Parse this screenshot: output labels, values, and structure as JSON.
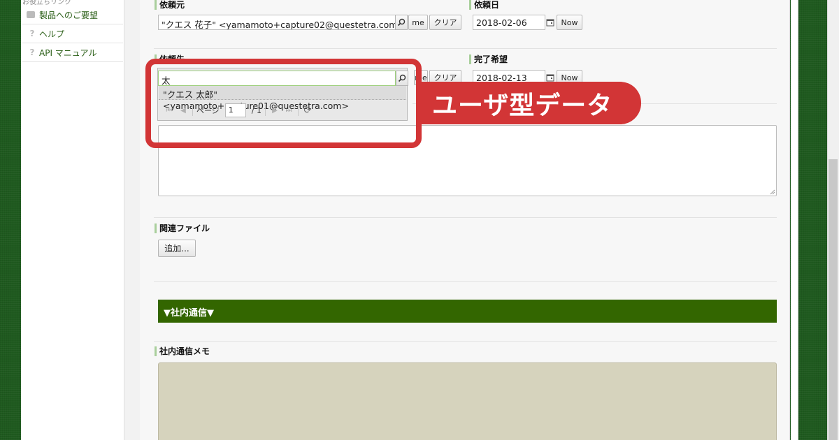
{
  "sidebar": {
    "truncated_heading": "お役立ちリンク",
    "items": [
      {
        "label": "製品へのご要望",
        "icon": "feedback-icon"
      },
      {
        "label": "ヘルプ",
        "icon": "help-icon"
      },
      {
        "label": "API マニュアル",
        "icon": "help-icon"
      }
    ]
  },
  "form": {
    "requester": {
      "label": "依頼元",
      "value": "\"クエス 花子\" <yamamoto+capture02@questetra.com>",
      "me_label": "me",
      "clear_label": "クリア"
    },
    "request_date": {
      "label": "依頼日",
      "value": "2018-02-06",
      "now_label": "Now"
    },
    "assignee": {
      "label": "依頼先",
      "value": "太",
      "me_label": "me",
      "clear_label": "クリア"
    },
    "due_date": {
      "label": "完了希望",
      "value": "2018-02-13",
      "now_label": "Now"
    },
    "attachments": {
      "label": "関連ファイル",
      "add_label": "追加..."
    },
    "internal_section": {
      "header": "▼社内通信▼",
      "memo_label": "社内通信メモ"
    }
  },
  "autocomplete": {
    "suggestion": "\"クエス 太郎\" <yamamoto+capture01@questetra.com>",
    "pager": {
      "page_label": "ページ",
      "page_value": "1",
      "total": "/ 1"
    }
  },
  "callout": {
    "text": "ユーザ型データ",
    "color": "#d23536"
  },
  "colors": {
    "section_header": "#336600",
    "memo_background": "#d6d3bd",
    "label_accent": "#a9cf9c"
  }
}
